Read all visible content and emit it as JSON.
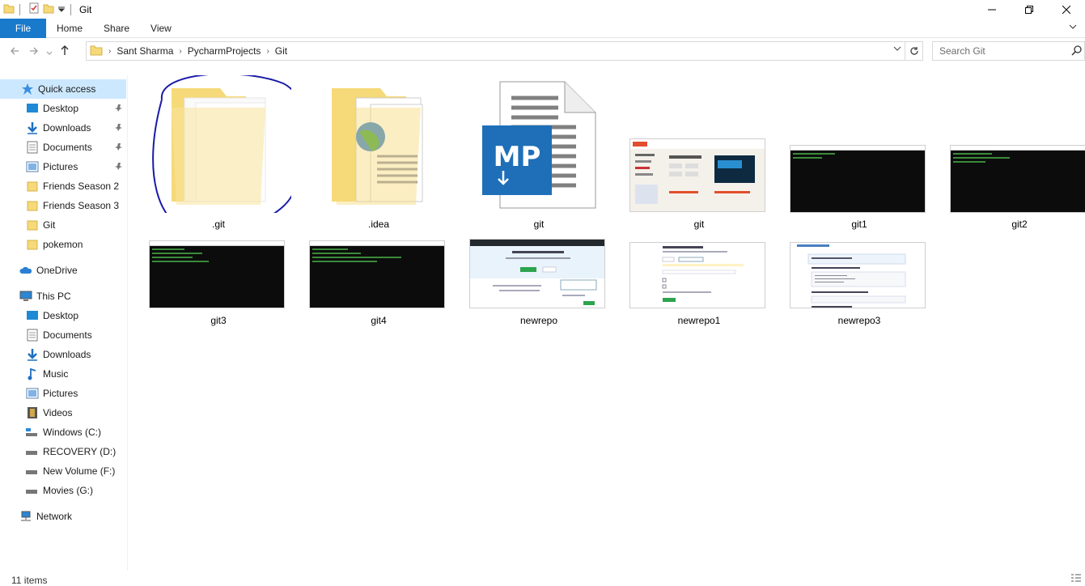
{
  "window": {
    "title": "Git"
  },
  "ribbon": {
    "tabs": [
      "File",
      "Home",
      "Share",
      "View"
    ]
  },
  "address": {
    "crumbs": [
      "Sant Sharma",
      "PycharmProjects",
      "Git"
    ]
  },
  "search": {
    "placeholder": "Search Git"
  },
  "sidebar": {
    "quick_access": "Quick access",
    "quick_items": [
      "Desktop",
      "Downloads",
      "Documents",
      "Pictures",
      "Friends Season 2",
      "Friends Season 3",
      "Git",
      "pokemon"
    ],
    "onedrive": "OneDrive",
    "this_pc": "This PC",
    "pc_items": [
      "Desktop",
      "Documents",
      "Downloads",
      "Music",
      "Pictures",
      "Videos",
      "Windows (C:)",
      "RECOVERY (D:)",
      "New Volume (F:)",
      "Movies (G:)"
    ],
    "network": "Network"
  },
  "files": [
    {
      "name": ".git",
      "kind": "folder"
    },
    {
      "name": ".idea",
      "kind": "folder-web"
    },
    {
      "name": "git",
      "kind": "mp-doc"
    },
    {
      "name": "git",
      "kind": "web-screenshot"
    },
    {
      "name": "git1",
      "kind": "terminal-screenshot"
    },
    {
      "name": "git2",
      "kind": "terminal-screenshot"
    },
    {
      "name": "git3",
      "kind": "terminal-screenshot"
    },
    {
      "name": "git4",
      "kind": "terminal-screenshot"
    },
    {
      "name": "newrepo",
      "kind": "web-screenshot"
    },
    {
      "name": "newrepo1",
      "kind": "web-screenshot"
    },
    {
      "name": "newrepo3",
      "kind": "web-screenshot"
    }
  ],
  "status": {
    "item_count": "11 items"
  },
  "colors": {
    "accent": "#1979ca",
    "selection": "#cce8ff",
    "annotation": "#1a1aa8",
    "folder": "#f6d978"
  }
}
